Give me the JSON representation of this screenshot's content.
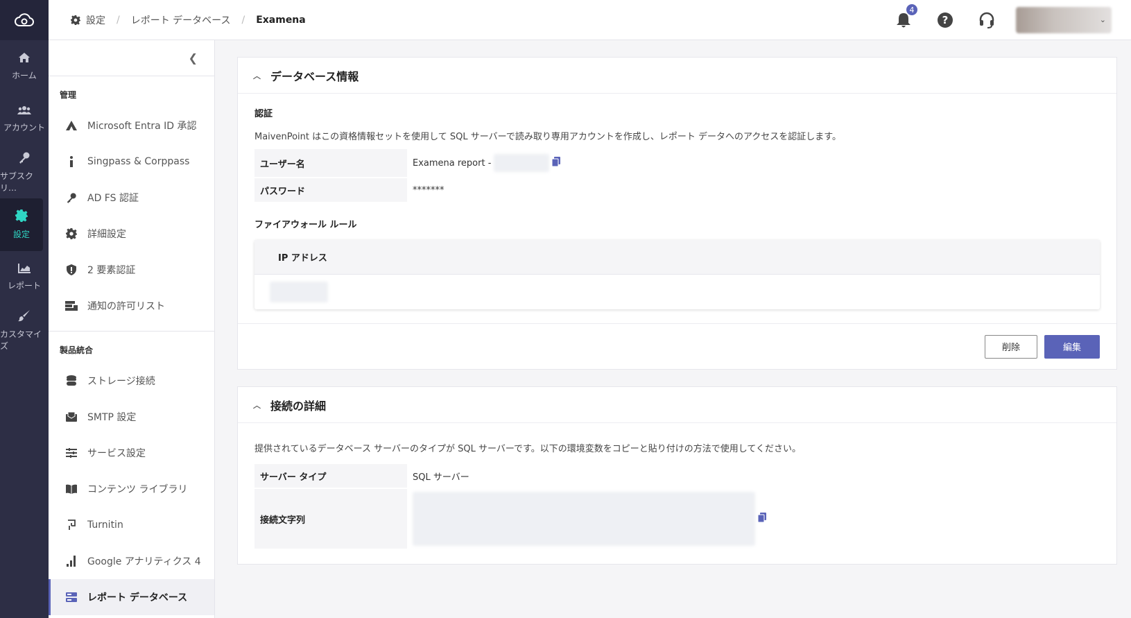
{
  "rail": {
    "items": [
      {
        "label": "ホーム",
        "icon": "home-icon"
      },
      {
        "label": "アカウント",
        "icon": "users-icon"
      },
      {
        "label": "サブスクリ…",
        "icon": "key-icon"
      },
      {
        "label": "設定",
        "icon": "gear-icon"
      },
      {
        "label": "レポート",
        "icon": "chart-icon"
      },
      {
        "label": "カスタマイズ",
        "icon": "brush-icon"
      }
    ]
  },
  "breadcrumb": {
    "root": "設定",
    "middle": "レポート データベース",
    "current": "Examena"
  },
  "topbar": {
    "notification_count": "4"
  },
  "sidebar": {
    "section_admin": "管理",
    "admin_items": [
      {
        "label": "Microsoft Entra ID 承認",
        "icon": "entra-icon"
      },
      {
        "label": "Singpass & Corppass",
        "icon": "info-icon"
      },
      {
        "label": "AD FS 認証",
        "icon": "key-icon"
      },
      {
        "label": "詳細設定",
        "icon": "gear-icon"
      },
      {
        "label": "2 要素認証",
        "icon": "shield-icon"
      },
      {
        "label": "通知の許可リスト",
        "icon": "allowlist-icon"
      }
    ],
    "section_integration": "製品統合",
    "integration_items": [
      {
        "label": "ストレージ接続",
        "icon": "database-icon"
      },
      {
        "label": "SMTP 設定",
        "icon": "mail-icon"
      },
      {
        "label": "サービス設定",
        "icon": "sliders-icon"
      },
      {
        "label": "コンテンツ ライブラリ",
        "icon": "book-icon"
      },
      {
        "label": "Turnitin",
        "icon": "turnitin-icon"
      },
      {
        "label": "Google アナリティクス 4",
        "icon": "analytics-icon"
      },
      {
        "label": "レポート データベース",
        "icon": "report-db-icon"
      }
    ]
  },
  "db_info": {
    "title": "データベース情報",
    "auth_title": "認証",
    "auth_desc": "MaivenPoint はこの資格情報セットを使用して SQL サーバーで読み取り専用アカウントを作成し、レポート データへのアクセスを認証します。",
    "username_label": "ユーザー名",
    "username_value": "Examena report -",
    "password_label": "パスワード",
    "password_value": "*******",
    "firewall_title": "ファイアウォール ルール",
    "ip_header": "IP アドレス",
    "delete_label": "削除",
    "edit_label": "編集"
  },
  "conn": {
    "title": "接続の詳細",
    "desc": "提供されているデータベース サーバーのタイプが SQL サーバーです。以下の環境変数をコピーと貼り付けの方法で使用してください。",
    "server_type_label": "サーバー タイプ",
    "server_type_value": "SQL サーバー",
    "conn_string_label": "接続文字列"
  }
}
